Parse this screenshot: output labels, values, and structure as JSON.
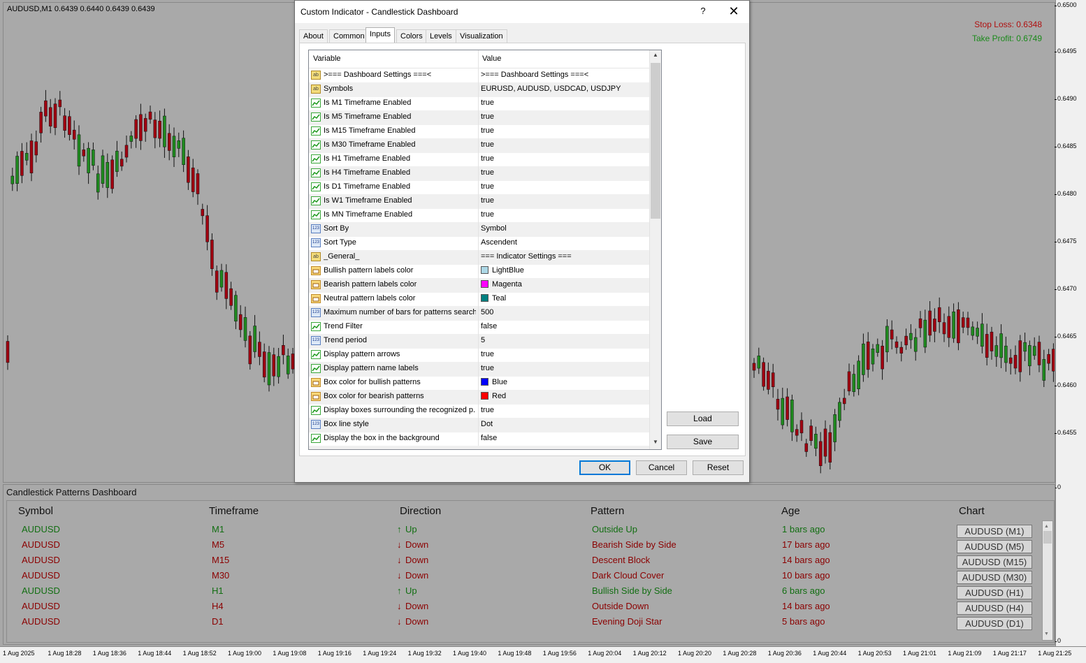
{
  "chart": {
    "symbol_info": "AUDUSD,M1  0.6439 0.6440 0.6439 0.6439",
    "stop_loss": "Stop Loss: 0.6348",
    "take_profit": "Take Profit: 0.6749",
    "bull_color": "#1f8a1f",
    "bear_color": "#a00010",
    "price_ticks": [
      "0.6500",
      "0.6495",
      "0.6490",
      "0.6485",
      "0.6480",
      "0.6475",
      "0.6470",
      "0.6465",
      "0.6460",
      "0.6455",
      "0",
      "0"
    ],
    "time_ticks": [
      "1 Aug 2025",
      "1 Aug 18:28",
      "1 Aug 18:36",
      "1 Aug 18:44",
      "1 Aug 18:52",
      "1 Aug 19:00",
      "1 Aug 19:08",
      "1 Aug 19:16",
      "1 Aug 19:24",
      "1 Aug 19:32",
      "1 Aug 19:40",
      "1 Aug 19:48",
      "1 Aug 19:56",
      "1 Aug 20:04",
      "1 Aug 20:12",
      "1 Aug 20:20",
      "1 Aug 20:28",
      "1 Aug 20:36",
      "1 Aug 20:44",
      "1 Aug 20:53",
      "1 Aug 21:01",
      "1 Aug 21:09",
      "1 Aug 21:17",
      "1 Aug 21:25"
    ]
  },
  "dialog": {
    "title": "Custom Indicator - Candlestick Dashboard",
    "help": "?",
    "close": "✕",
    "tabs": [
      "About",
      "Common",
      "Inputs",
      "Colors",
      "Levels",
      "Visualization"
    ],
    "active_tab": "Inputs",
    "col_variable": "Variable",
    "col_value": "Value",
    "rows": [
      {
        "type": "ab",
        "var": ">=== Dashboard Settings ===<",
        "val": ">=== Dashboard Settings ===<"
      },
      {
        "type": "ab",
        "var": "Symbols",
        "val": "EURUSD, AUDUSD, USDCAD, USDJPY"
      },
      {
        "type": "bool",
        "var": "Is M1 Timeframe Enabled",
        "val": "true"
      },
      {
        "type": "bool",
        "var": "Is M5 Timeframe Enabled",
        "val": "true"
      },
      {
        "type": "bool",
        "var": "Is M15 Timeframe Enabled",
        "val": "true"
      },
      {
        "type": "bool",
        "var": "Is M30 Timeframe Enabled",
        "val": "true"
      },
      {
        "type": "bool",
        "var": "Is H1 Timeframe Enabled",
        "val": "true"
      },
      {
        "type": "bool",
        "var": "Is H4 Timeframe Enabled",
        "val": "true"
      },
      {
        "type": "bool",
        "var": "Is D1 Timeframe Enabled",
        "val": "true"
      },
      {
        "type": "bool",
        "var": "Is W1 Timeframe Enabled",
        "val": "true"
      },
      {
        "type": "bool",
        "var": "Is MN Timeframe Enabled",
        "val": "true"
      },
      {
        "type": "num",
        "var": "Sort By",
        "val": "Symbol"
      },
      {
        "type": "num",
        "var": "Sort Type",
        "val": "Ascendent"
      },
      {
        "type": "ab",
        "var": "_General_",
        "val": "=== Indicator Settings ==="
      },
      {
        "type": "color",
        "var": "Bullish pattern labels color",
        "val": "LightBlue",
        "swatch": "#add8e6"
      },
      {
        "type": "color",
        "var": "Bearish pattern labels color",
        "val": "Magenta",
        "swatch": "#ff00ff"
      },
      {
        "type": "color",
        "var": "Neutral pattern labels color",
        "val": "Teal",
        "swatch": "#008080"
      },
      {
        "type": "num",
        "var": "Maximum number of bars for patterns search",
        "val": "500"
      },
      {
        "type": "bool",
        "var": "Trend Filter",
        "val": "false"
      },
      {
        "type": "num",
        "var": "Trend period",
        "val": "5"
      },
      {
        "type": "bool",
        "var": "Display pattern arrows",
        "val": "true"
      },
      {
        "type": "bool",
        "var": "Display pattern name labels",
        "val": "true"
      },
      {
        "type": "color",
        "var": "Box color for bullish patterns",
        "val": "Blue",
        "swatch": "#0000ff"
      },
      {
        "type": "color",
        "var": "Box color for bearish patterns",
        "val": "Red",
        "swatch": "#ff0000"
      },
      {
        "type": "bool",
        "var": "Display boxes surrounding the recognized p...",
        "val": "true"
      },
      {
        "type": "num",
        "var": "Box line style",
        "val": "Dot"
      },
      {
        "type": "bool",
        "var": "Display the box in the background",
        "val": "false"
      }
    ],
    "load": "Load",
    "save": "Save",
    "ok": "OK",
    "cancel": "Cancel",
    "reset": "Reset"
  },
  "dashboard": {
    "title": "Candlestick Patterns Dashboard",
    "headers": [
      "Symbol",
      "Timeframe",
      "Direction",
      "Pattern",
      "Age",
      "Chart"
    ],
    "rows": [
      {
        "symbol": "AUDUSD",
        "tf": "M1",
        "dir": "Up",
        "pattern": "Outside Up",
        "age": "1 bars ago",
        "chart": "AUDUSD (M1)"
      },
      {
        "symbol": "AUDUSD",
        "tf": "M5",
        "dir": "Down",
        "pattern": "Bearish Side by Side",
        "age": "17 bars ago",
        "chart": "AUDUSD (M5)"
      },
      {
        "symbol": "AUDUSD",
        "tf": "M15",
        "dir": "Down",
        "pattern": "Descent Block",
        "age": "14 bars ago",
        "chart": "AUDUSD (M15)"
      },
      {
        "symbol": "AUDUSD",
        "tf": "M30",
        "dir": "Down",
        "pattern": "Dark Cloud Cover",
        "age": "10 bars ago",
        "chart": "AUDUSD (M30)"
      },
      {
        "symbol": "AUDUSD",
        "tf": "H1",
        "dir": "Up",
        "pattern": "Bullish Side by Side",
        "age": "6 bars ago",
        "chart": "AUDUSD (H1)"
      },
      {
        "symbol": "AUDUSD",
        "tf": "H4",
        "dir": "Down",
        "pattern": "Outside Down",
        "age": "14 bars ago",
        "chart": "AUDUSD (H4)"
      },
      {
        "symbol": "AUDUSD",
        "tf": "D1",
        "dir": "Down",
        "pattern": "Evening Doji Star",
        "age": "5 bars ago",
        "chart": "AUDUSD (D1)"
      }
    ]
  }
}
